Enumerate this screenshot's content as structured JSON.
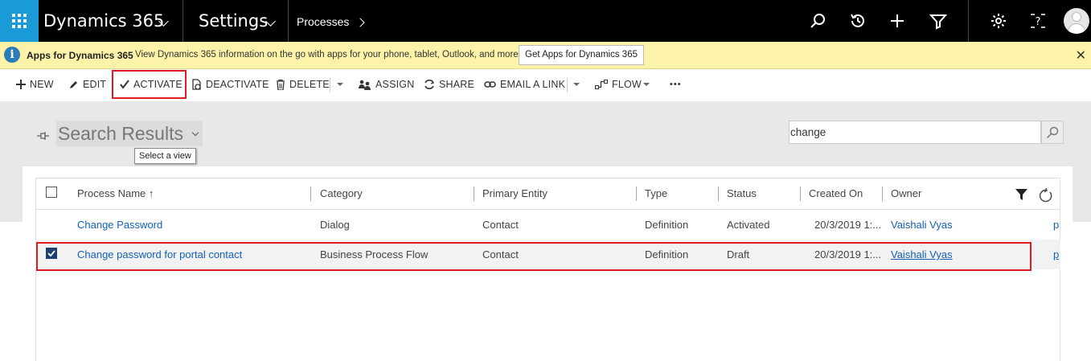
{
  "nav": {
    "app_title": "Dynamics 365",
    "area": "Settings",
    "breadcrumb": "Processes"
  },
  "notification": {
    "title": "Apps for Dynamics 365",
    "message": "View Dynamics 365 information on the go with apps for your phone, tablet, Outlook, and more!",
    "button": "Get Apps for Dynamics 365",
    "close": "✕"
  },
  "commands": {
    "new": "NEW",
    "edit": "EDIT",
    "activate": "ACTIVATE",
    "deactivate": "DEACTIVATE",
    "delete": "DELETE",
    "assign": "ASSIGN",
    "share": "SHARE",
    "email_link": "EMAIL A LINK",
    "flow": "FLOW",
    "more": "•••"
  },
  "view": {
    "title": "Search Results",
    "tooltip": "Select a view",
    "search_value": "change"
  },
  "grid": {
    "columns": [
      "Process Name ↑",
      "Category",
      "Primary Entity",
      "Type",
      "Status",
      "Created On",
      "Owner"
    ],
    "rows": [
      {
        "name": "Change Password",
        "category": "Dialog",
        "entity": "Contact",
        "type": "Definition",
        "status": "Activated",
        "created": "20/3/2019 1:...",
        "owner": "Vaishali Vyas",
        "extra": "p",
        "selected": false
      },
      {
        "name": "Change password for portal contact",
        "category": "Business Process Flow",
        "entity": "Contact",
        "type": "Definition",
        "status": "Draft",
        "created": "20/3/2019 1:...",
        "owner": "Vaishali Vyas",
        "extra": "p",
        "selected": true
      }
    ]
  },
  "colors": {
    "waffle_bg": "#1a9bd7",
    "notify_bg": "#fdf3a8",
    "highlight": "#e01b24",
    "link": "#1160b7"
  }
}
